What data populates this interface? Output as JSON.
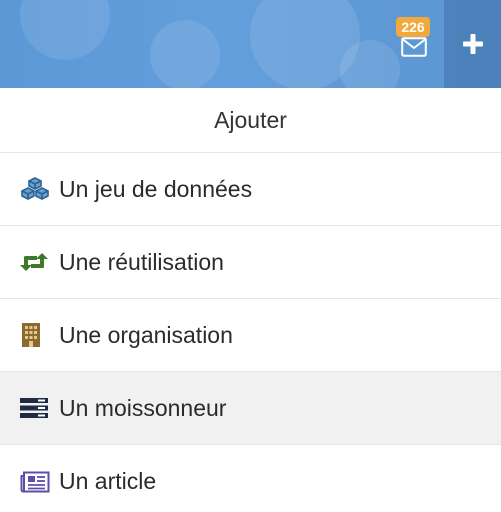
{
  "header": {
    "notifications": {
      "count": "226",
      "icon": "envelope-icon"
    },
    "add_button": {
      "icon": "plus-icon"
    }
  },
  "menu": {
    "title": "Ajouter",
    "items": [
      {
        "label": "Un jeu de données",
        "icon": "cubes-icon",
        "color": "#2a6496"
      },
      {
        "label": "Une réutilisation",
        "icon": "retweet-icon",
        "color": "#3c7a2a"
      },
      {
        "label": "Une organisation",
        "icon": "building-icon",
        "color": "#8a6a2f"
      },
      {
        "label": "Un moissonneur",
        "icon": "server-icon",
        "color": "#1f2a44"
      },
      {
        "label": "Un article",
        "icon": "newspaper-icon",
        "color": "#5a4fa8"
      }
    ]
  },
  "colors": {
    "header_bg": "#5c98d6",
    "badge_bg": "#f0a93a",
    "active_row_bg": "#f1f1f1"
  }
}
